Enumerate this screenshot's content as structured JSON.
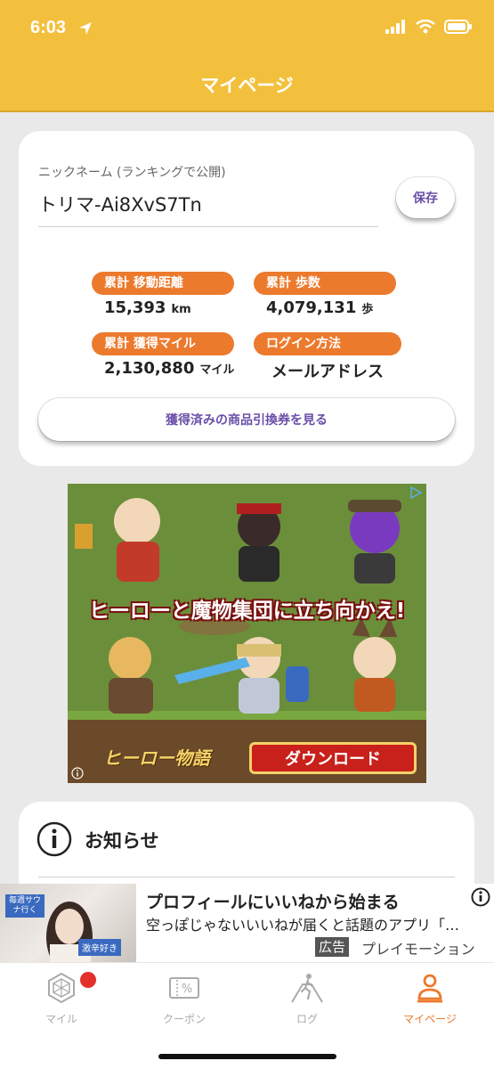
{
  "status_bar": {
    "time": "6:03"
  },
  "header": {
    "title": "マイページ"
  },
  "profile": {
    "nickname_label": "ニックネーム (ランキングで公開)",
    "nickname_value": "トリマ-Ai8XvS7Tn",
    "save_label": "保存",
    "stats": [
      {
        "label": "累計 移動距離",
        "value": "15,393",
        "unit": "km"
      },
      {
        "label": "累計 歩数",
        "value": "4,079,131",
        "unit": "歩"
      },
      {
        "label": "累計 獲得マイル",
        "value": "2,130,880",
        "unit": "マイル"
      },
      {
        "label": "ログイン方法",
        "value": "メールアドレス",
        "unit": ""
      }
    ],
    "coupon_link_label": "獲得済みの商品引換券を見る"
  },
  "ad_banner": {
    "slogan": "ヒーローと魔物集団に立ち向かえ!",
    "logo_text": "ヒーロー物語",
    "download_label": "ダウンロード"
  },
  "notice": {
    "title": "お知らせ"
  },
  "bottom_ad": {
    "image_tags": [
      "毎週サウナ行く",
      "激辛好き"
    ],
    "title": "プロフィールにいいねから始まる",
    "text": "空っぽじゃないいいねが届くと話題のアプリ「…",
    "ad_label": "広告",
    "advertiser": "プレイモーション"
  },
  "tab_bar": {
    "tabs": [
      {
        "label": "マイル",
        "icon": "mile-hexagon-icon",
        "active": false,
        "badge": true
      },
      {
        "label": "クーポン",
        "icon": "coupon-icon",
        "active": false,
        "badge": false
      },
      {
        "label": "ログ",
        "icon": "log-walking-icon",
        "active": false,
        "badge": false
      },
      {
        "label": "マイページ",
        "icon": "person-icon",
        "active": true,
        "badge": false
      }
    ]
  },
  "colors": {
    "header": "#f3c03d",
    "accent_orange": "#ec7a2d",
    "link_purple": "#6a4fa8",
    "badge_red": "#e4302a"
  }
}
